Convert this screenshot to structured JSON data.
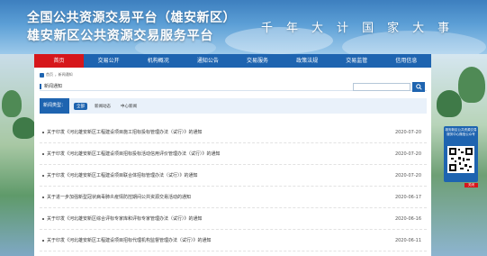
{
  "header": {
    "title_line1": "全国公共资源交易平台（雄安新区）",
    "title_line2": "雄安新区公共资源交易服务平台",
    "slogan": [
      "千",
      "年",
      "大",
      "计",
      "国",
      "家",
      "大",
      "事"
    ]
  },
  "nav": {
    "items": [
      "首页",
      "交易公开",
      "机构概况",
      "通知公告",
      "交易服务",
      "政策法规",
      "交易监管",
      "信用信息"
    ],
    "active_index": 0
  },
  "breadcrumb": [
    "首页",
    "新闻通知"
  ],
  "section": {
    "title": "新闻通知",
    "search_placeholder": ""
  },
  "filter": {
    "label": "新闻类型：",
    "options": [
      "全部",
      "新闻动态",
      "中心新闻"
    ],
    "active_index": 0
  },
  "news": [
    {
      "title": "关于印发《河北雄安新区工程建设项目施工招标投标管理办法（试行）》的通知",
      "date": "2020-07-20"
    },
    {
      "title": "关于印发《河北雄安新区工程建设项目招标投标活动信用评价管理办法（试行）》的通知",
      "date": "2020-07-20"
    },
    {
      "title": "关于印发《河北雄安新区工程建设项目联合体招标管理办法（试行）》的通知",
      "date": "2020-07-20"
    },
    {
      "title": "关于进一步加强新型冠状病毒肺炎疫情防控期间公共资源交易活动的通知",
      "date": "2020-06-17"
    },
    {
      "title": "关于印发《河北雄安新区综合评标专家库和评标专家管理办法（试行）》的通知",
      "date": "2020-06-16"
    },
    {
      "title": "关于印发《河北雄安新区工程建设项目招标代理机构监督管理办法（试行）》的通知",
      "date": "2020-06-11"
    }
  ],
  "qr_widget": {
    "caption": "雄安新区公共资源交易服务中心微信公众号",
    "close_label": "关闭"
  },
  "colors": {
    "nav_bg": "#1e64b0",
    "nav_active": "#d6161b",
    "accent": "#1e64b0"
  }
}
